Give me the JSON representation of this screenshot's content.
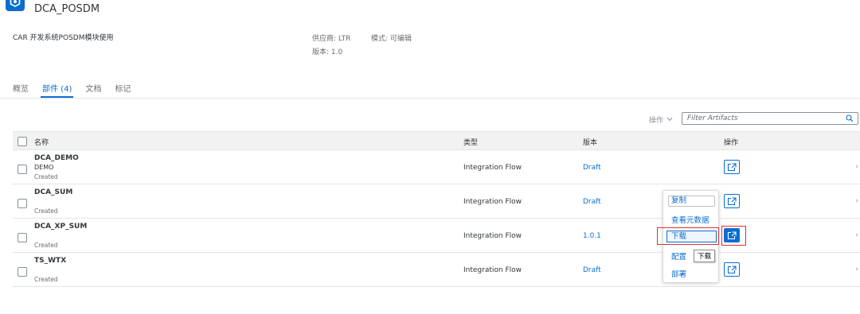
{
  "header": {
    "title": "DCA_POSDM",
    "description": "CAR 开发系统POSDM模块使用",
    "vendor_label": "供应商: LTR",
    "mode_label": "模式: 可编辑",
    "version_label": "版本: 1.0"
  },
  "tabs": [
    {
      "label": "概览"
    },
    {
      "label": "部件 (4)"
    },
    {
      "label": "文档"
    },
    {
      "label": "标记"
    }
  ],
  "toolbar": {
    "actions_label": "操作",
    "filter_placeholder": "Filter Artifacts"
  },
  "table": {
    "columns": {
      "name": "名称",
      "type": "类型",
      "version": "版本",
      "actions": "操作"
    },
    "rows": [
      {
        "name": "DCA_DEMO",
        "subtitle": "DEMO",
        "status": "Created",
        "type": "Integration Flow",
        "version": "Draft"
      },
      {
        "name": "DCA_SUM",
        "subtitle": "",
        "status": "Created",
        "type": "Integration Flow",
        "version": "Draft"
      },
      {
        "name": "DCA_XP_SUM",
        "subtitle": "",
        "status": "Created",
        "type": "Integration Flow",
        "version": "1.0.1"
      },
      {
        "name": "TS_WTX",
        "subtitle": "",
        "status": "Created",
        "type": "Integration Flow",
        "version": "Draft"
      }
    ]
  },
  "context_menu": {
    "copy": "复制",
    "view_metadata": "查看元数据",
    "download": "下载",
    "configure": "配置",
    "deploy": "部署"
  },
  "tooltip": "下载",
  "colors": {
    "accent": "#0a6ed1",
    "highlight": "#e03131"
  },
  "icons": {
    "package": "package-icon",
    "search": "search-icon",
    "action": "external-action-icon"
  }
}
